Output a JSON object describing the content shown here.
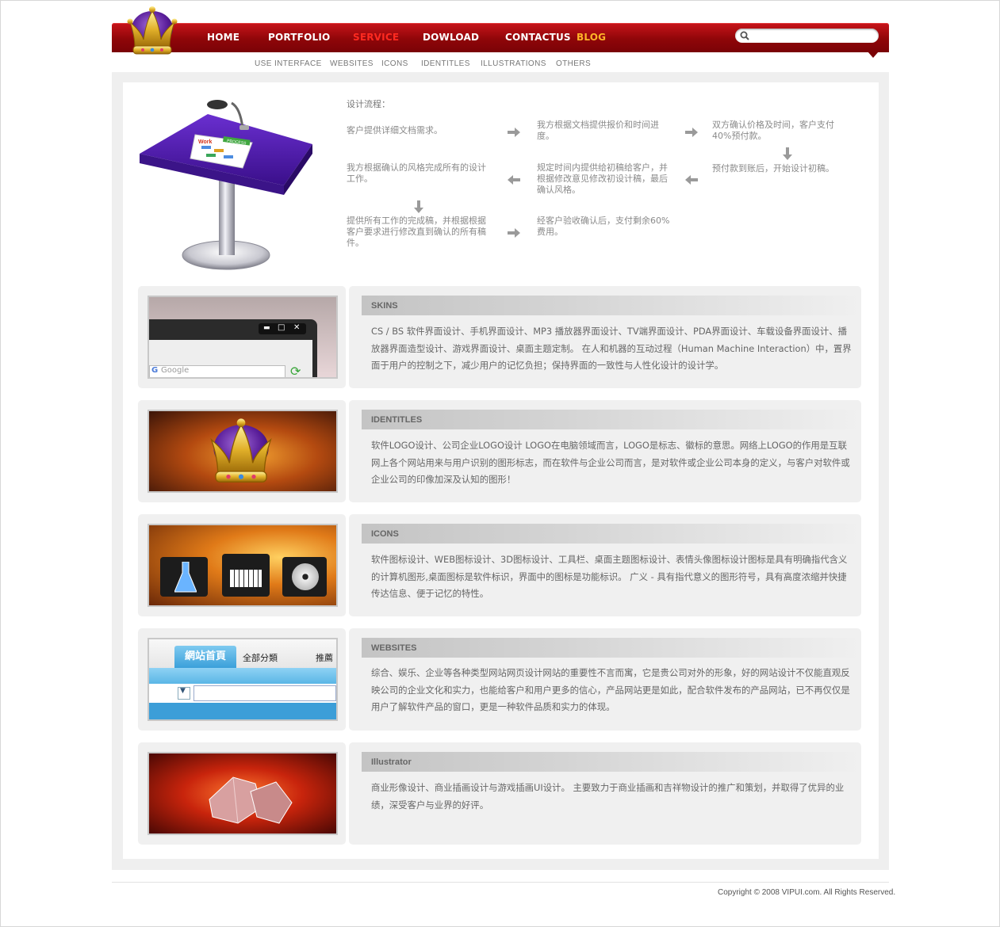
{
  "header": {
    "nav": [
      "HOME",
      "PORTFOLIO",
      "SERVICE",
      "DOWLOAD",
      "CONTACTUS",
      "BLOG"
    ],
    "active_nav": "SERVICE",
    "search_placeholder": "",
    "subnav": [
      "USE INTERFACE",
      "WEBSITES",
      "ICONS",
      "IDENTITLES",
      "ILLUSTRATIONS",
      "OTHERS"
    ],
    "brand_color": "#a50b10"
  },
  "process": {
    "title": "设计流程：",
    "steps": [
      "客户提供详细文档需求。",
      "我方根据文档提供报价和时间进度。",
      "双方确认价格及时间，客户支付40%预付款。",
      "预付款到账后，开始设计初稿。",
      "规定时间内提供给初稿给客户，并根据修改意见修改初设计稿，最后确认风格。",
      "我方根据确认的风格完成所有的设计工作。",
      "提供所有工作的完成稿，并根据根据客户要求进行修改直到确认的所有稿件。",
      "经客户验收确认后，支付剩余60%费用。"
    ],
    "podium_labels": [
      "Work",
      "PROCESS"
    ]
  },
  "sections": [
    {
      "heading": "SKINS",
      "body": "CS / BS 软件界面设计、手机界面设计、MP3 播放器界面设计、TV端界面设计、PDA界面设计、车载设备界面设计、播放器界面造型设计、游戏界面设计、桌面主题定制。 在人和机器的互动过程（Human Machine Interaction）中，置界面于用户的控制之下，减少用户的记忆负担；保持界面的一致性与人性化设计的设计学。",
      "thumb_text": "Google"
    },
    {
      "heading": "IDENTITLES",
      "body": "软件LOGO设计、公司企业LOGO设计 LOGO在电脑领域而言，LOGO是标志、徽标的意思。网络上LOGO的作用是互联网上各个网站用来与用户识别的图形标志，而在软件与企业公司而言，是对软件或企业公司本身的定义，与客户对软件或企业公司的印像加深及认知的图形！"
    },
    {
      "heading": "ICONS",
      "body": "软件图标设计、WEB图标设计、3D图标设计、工具栏、桌面主题图标设计、表情头像图标设计图标是具有明确指代含义的计算机图形,桌面图标是软件标识，界面中的图标是功能标识。 广义 - 具有指代意义的图形符号，具有高度浓缩并快捷传达信息、便于记忆的特性。"
    },
    {
      "heading": "WEBSITES",
      "body": "综合、娱乐、企业等各种类型网站网页设计网站的重要性不言而寓，它是贵公司对外的形象，好的网站设计不仅能直观反映公司的企业文化和实力，也能给客户和用户更多的信心，产品网站更是如此，配合软件发布的产品网站，已不再仅仅是用户了解软件产品的窗口，更是一种软件品质和实力的体现。",
      "thumb_tabs": [
        "網站首頁",
        "全部分類",
        "推薦"
      ]
    },
    {
      "heading": "Illustrator",
      "body": "商业形像设计、商业插画设计与游戏插画UI设计。 主要致力于商业插画和吉祥物设计的推广和策划，并取得了优异的业绩，深受客户与业界的好评。"
    }
  ],
  "footer": {
    "copyright": "Copyright © 2008 VIPUI.com. All Rights Reserved."
  }
}
